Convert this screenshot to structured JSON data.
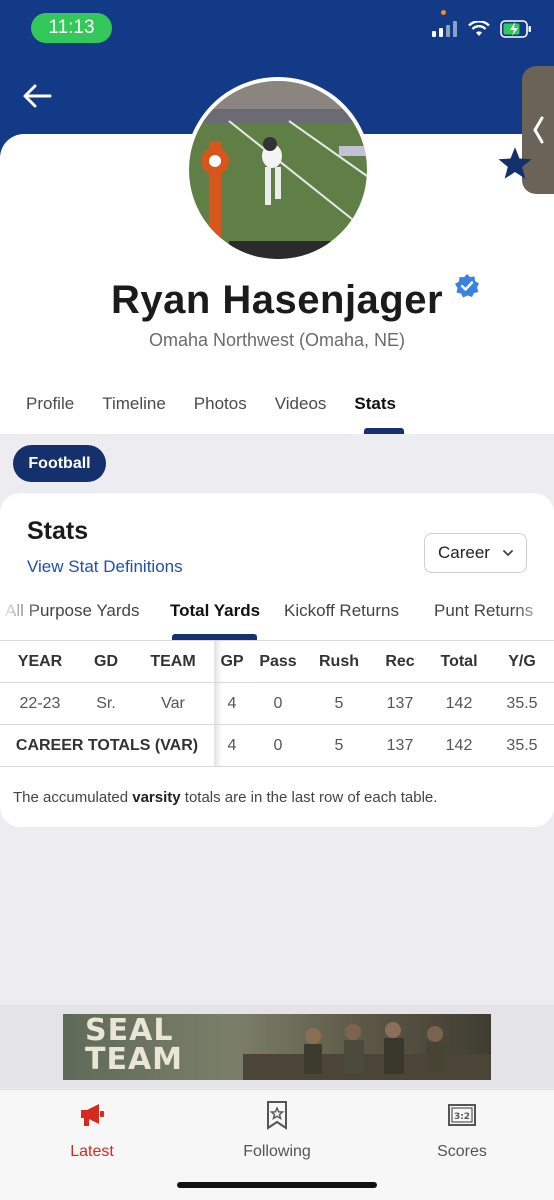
{
  "status_bar": {
    "time": "11:13"
  },
  "player": {
    "name": "Ryan Hasenjager",
    "school": "Omaha Northwest (Omaha, NE)"
  },
  "profile_tabs": [
    {
      "label": "Profile"
    },
    {
      "label": "Timeline"
    },
    {
      "label": "Photos"
    },
    {
      "label": "Videos"
    },
    {
      "label": "Stats",
      "active": true
    }
  ],
  "sport_filter": {
    "label": "Football"
  },
  "stats": {
    "title": "Stats",
    "definitions_link": "View Stat Definitions",
    "period_select": {
      "selected": "Career"
    },
    "subtabs": [
      {
        "label": "All Purpose Yards"
      },
      {
        "label": "Total Yards",
        "active": true
      },
      {
        "label": "Kickoff Returns"
      },
      {
        "label": "Punt Returns"
      }
    ],
    "table": {
      "headers": [
        "YEAR",
        "GD",
        "TEAM",
        "GP",
        "Pass",
        "Rush",
        "Rec",
        "Total",
        "Y/G"
      ],
      "rows": [
        [
          "22-23",
          "Sr.",
          "Var",
          "4",
          "0",
          "5",
          "137",
          "142",
          "35.5"
        ]
      ],
      "totals": {
        "label": "CAREER TOTALS (VAR)",
        "values": [
          "4",
          "0",
          "5",
          "137",
          "142",
          "35.5"
        ]
      }
    },
    "note_before": "The accumulated ",
    "note_bold": "varsity",
    "note_after": " totals are in the last row of each table."
  },
  "ad": {
    "line1": "SEAL",
    "line2": "TEAM"
  },
  "bottom_nav": [
    {
      "label": "Latest",
      "icon": "megaphone-icon",
      "active": true
    },
    {
      "label": "Following",
      "icon": "bookmark-star-icon"
    },
    {
      "label": "Scores",
      "icon": "scoreboard-icon"
    }
  ],
  "colors": {
    "header_bg": "#123a86",
    "accent_navy": "#15316d",
    "link_blue": "#1e4fb6",
    "active_red": "#d42b1e",
    "time_pill": "#34c759"
  }
}
